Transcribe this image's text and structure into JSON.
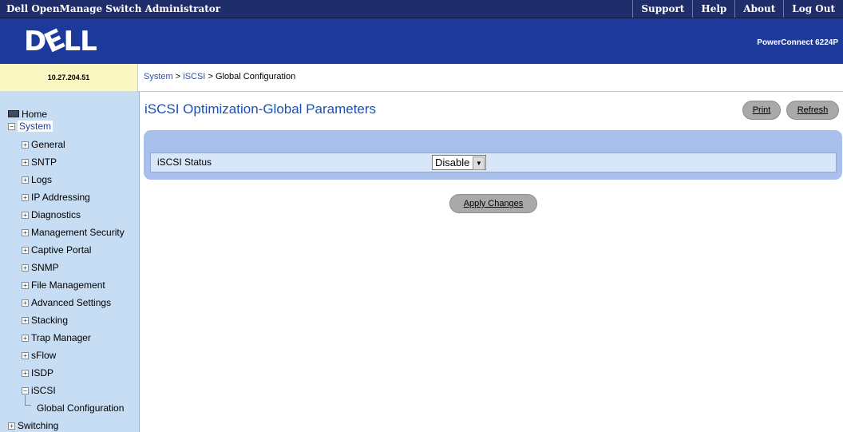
{
  "app": {
    "title": "Dell OpenManage Switch Administrator",
    "links": [
      "Support",
      "Help",
      "About",
      "Log Out"
    ]
  },
  "banner": {
    "logo_text": "DELL",
    "model": "PowerConnect 6224P"
  },
  "device": {
    "ip": "10.27.204.51"
  },
  "breadcrumb": {
    "system": "System",
    "iscsi": "iSCSI",
    "current": "Global Configuration",
    "separator": ">"
  },
  "sidebar": {
    "home": "Home",
    "system": "System",
    "items": [
      "General",
      "SNTP",
      "Logs",
      "IP Addressing",
      "Diagnostics",
      "Management Security",
      "Captive Portal",
      "SNMP",
      "File Management",
      "Advanced Settings",
      "Stacking",
      "Trap Manager",
      "sFlow",
      "ISDP",
      "iSCSI"
    ],
    "sub_item": "Global Configuration",
    "switching": "Switching"
  },
  "page": {
    "title": "iSCSI Optimization-Global Parameters",
    "print_label": "Print",
    "refresh_label": "Refresh",
    "status_label": "iSCSI Status",
    "status_value": "Disable",
    "apply_label": "Apply Changes"
  }
}
